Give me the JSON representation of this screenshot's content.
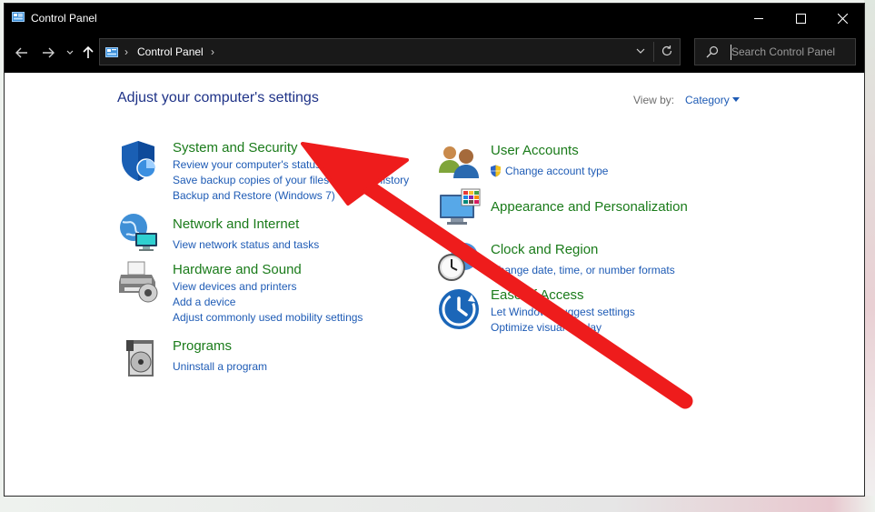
{
  "window": {
    "title": "Control Panel",
    "minimize_icon": "minimize-icon",
    "maximize_icon": "maximize-icon",
    "close_icon": "close-icon"
  },
  "nav": {
    "back_icon": "back-arrow-icon",
    "forward_icon": "forward-arrow-icon",
    "recent_icon": "chevron-down-icon",
    "up_icon": "up-arrow-icon"
  },
  "address": {
    "crumb": "Control Panel",
    "separator": "›",
    "refresh_icon": "refresh-icon"
  },
  "search": {
    "placeholder": "Search Control Panel",
    "value": ""
  },
  "header": {
    "title": "Adjust your computer's settings",
    "view_by_label": "View by:",
    "view_by_value": "Category"
  },
  "categories_left": [
    {
      "title": "System and Security",
      "icon": "shield-icon",
      "links": [
        "Review your computer's status",
        "Save backup copies of your files with File History",
        "Backup and Restore (Windows 7)"
      ]
    },
    {
      "title": "Network and Internet",
      "icon": "network-globe-icon",
      "links": [
        "View network status and tasks"
      ]
    },
    {
      "title": "Hardware and Sound",
      "icon": "printer-icon",
      "links": [
        "View devices and printers",
        "Add a device",
        "Adjust commonly used mobility settings"
      ]
    },
    {
      "title": "Programs",
      "icon": "programs-disc-icon",
      "links": [
        "Uninstall a program"
      ]
    }
  ],
  "categories_right": [
    {
      "title": "User Accounts",
      "icon": "users-icon",
      "links": [
        "Change account type"
      ],
      "link_icon": "uac-shield-icon"
    },
    {
      "title": "Appearance and Personalization",
      "icon": "monitor-palette-icon",
      "links": []
    },
    {
      "title": "Clock and Region",
      "icon": "clock-globe-icon",
      "links": [
        "Change date, time, or number formats"
      ]
    },
    {
      "title": "Ease of Access",
      "icon": "ease-of-access-icon",
      "links": [
        "Let Windows suggest settings",
        "Optimize visual display"
      ]
    }
  ],
  "annotation": {
    "icon": "red-pointer-arrow-icon",
    "color": "#ee1c1c"
  },
  "colors": {
    "titlebar": "#000000",
    "heading": "#1e3287",
    "category_title": "#1a7b1a",
    "link": "#1e5bb5"
  }
}
